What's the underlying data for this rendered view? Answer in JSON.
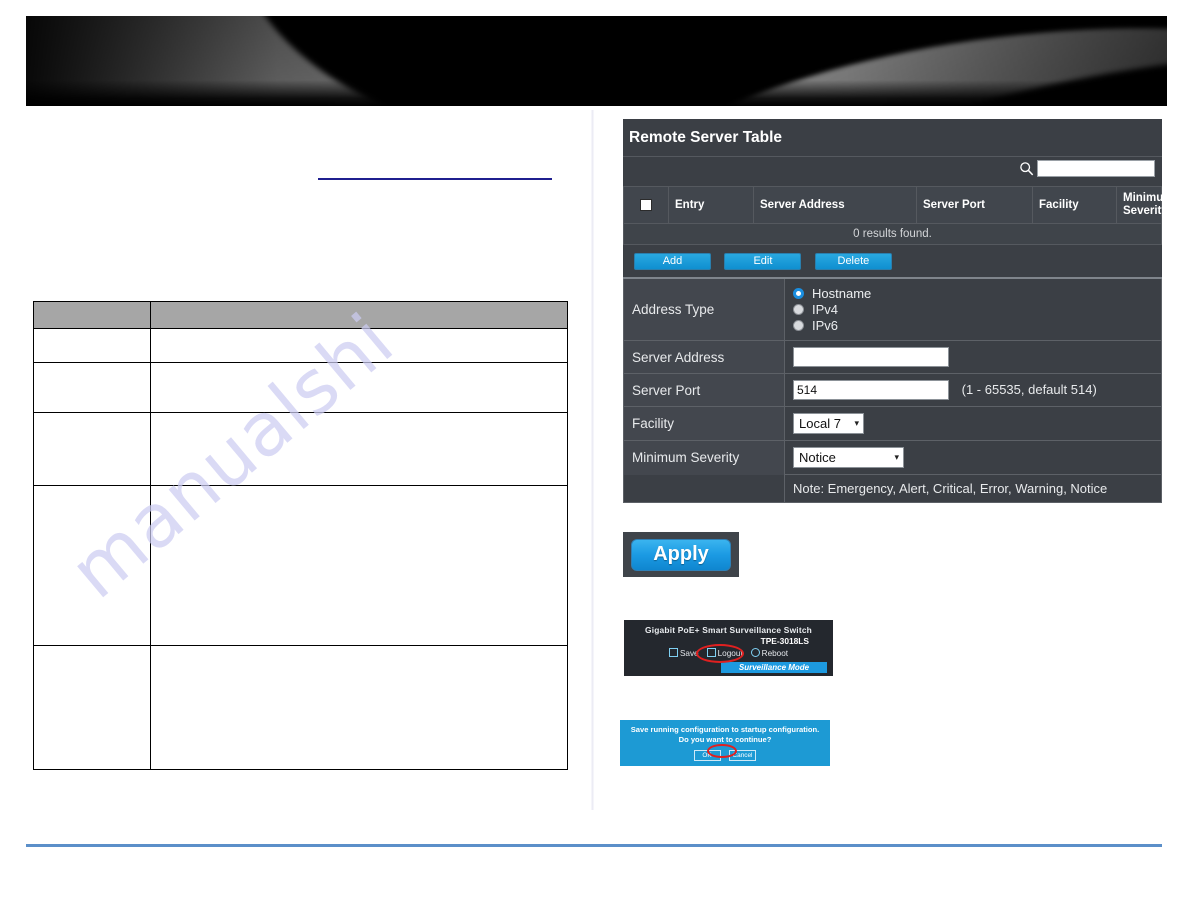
{
  "banner": {
    "alt": "dark abstract swoosh banner"
  },
  "left_column": {
    "doc_table": {
      "header": [
        "",
        ""
      ],
      "rows": [
        [
          "",
          ""
        ],
        [
          "",
          ""
        ],
        [
          "",
          ""
        ],
        [
          "",
          ""
        ],
        [
          "",
          ""
        ]
      ]
    }
  },
  "panel": {
    "title": "Remote Server Table",
    "search": {
      "value": "",
      "placeholder": "",
      "icon": "search-icon"
    },
    "grid": {
      "columns": [
        "",
        "Entry",
        "Server Address",
        "Server Port",
        "Facility",
        "Minimum Severity"
      ],
      "empty_text": "0 results found."
    },
    "buttons": {
      "add": "Add",
      "edit": "Edit",
      "delete": "Delete"
    },
    "form": {
      "address_type": {
        "label": "Address Type",
        "options": [
          "Hostname",
          "IPv4",
          "IPv6"
        ],
        "selected": "Hostname"
      },
      "server_address": {
        "label": "Server Address",
        "value": ""
      },
      "server_port": {
        "label": "Server Port",
        "value": "514",
        "hint": "(1 - 65535, default 514)"
      },
      "facility": {
        "label": "Facility",
        "value": "Local 7"
      },
      "minimum_severity": {
        "label": "Minimum Severity",
        "value": "Notice"
      },
      "note": "Note: Emergency, Alert, Critical, Error, Warning, Notice"
    }
  },
  "apply": {
    "label": "Apply"
  },
  "device": {
    "title": "Gigabit PoE+ Smart Surveillance Switch",
    "model": "TPE-3018LS",
    "save": "Save",
    "logout": "Logout",
    "reboot": "Reboot",
    "mode": "Surveillance Mode"
  },
  "save_dialog": {
    "message": "Save running configuration to startup configuration. Do you want to continue?",
    "ok": "OK",
    "cancel": "Cancel"
  },
  "watermark": {
    "text": "manualshi"
  },
  "colors": {
    "accent_blue": "#1d9ae0",
    "panel_bg": "#3b3f45",
    "panel_label_bg": "#43474e",
    "doc_header_gray": "#a6a6a6",
    "rule_blue": "#1f1f8f",
    "footer_blue": "#5b8fc9",
    "highlight_red": "#e02020"
  }
}
